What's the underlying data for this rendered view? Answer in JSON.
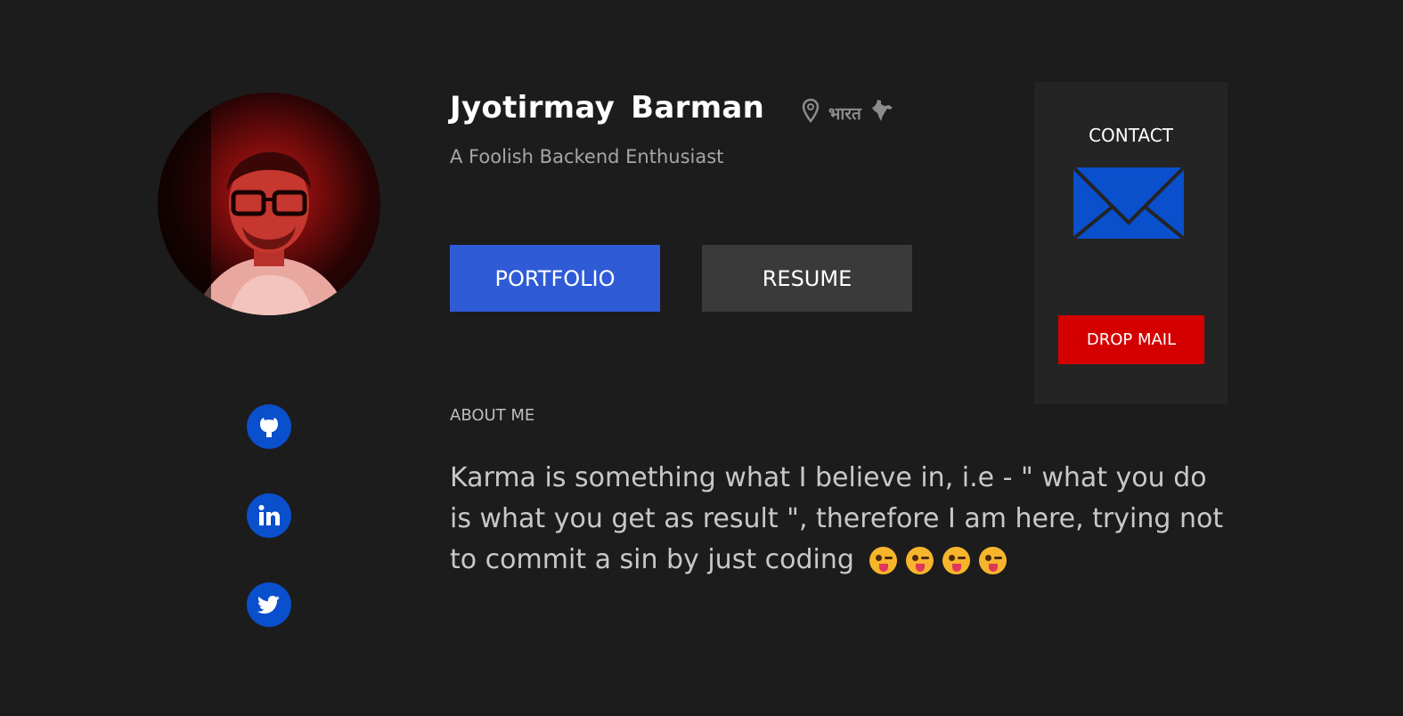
{
  "profile": {
    "name": "Jyotirmay Barman",
    "location": "भारत",
    "tagline": "A Foolish Backend Enthusiast"
  },
  "buttons": {
    "portfolio_label": "PORTFOLIO",
    "resume_label": "RESUME"
  },
  "contact": {
    "title": "CONTACT",
    "drop_mail_label": "DROP MAIL"
  },
  "social": [
    {
      "name": "github-icon"
    },
    {
      "name": "linkedin-icon"
    },
    {
      "name": "twitter-icon"
    }
  ],
  "about": {
    "heading": "ABOUT ME",
    "text": "Karma is something what I believe in, i.e - \" what you do is what you get as result \", therefore I am here, trying not to commit a sin by just coding",
    "emoji_count": 4,
    "emoji_name": "face-with-tongue"
  },
  "colors": {
    "background": "#1c1c1c",
    "portfolio_button": "#2f5bd6",
    "resume_button": "#3a3a3a",
    "contact_card": "#242424",
    "drop_mail_button": "#d40000",
    "social_icon_bg": "#0a4fcc",
    "mail_icon": "#0a4fcc"
  }
}
